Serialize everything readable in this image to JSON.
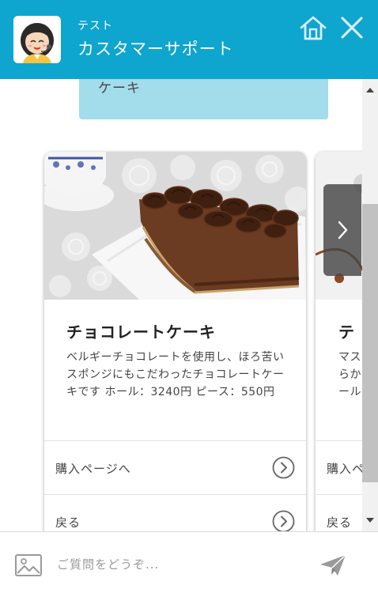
{
  "header": {
    "subtitle": "テスト",
    "title": "カスタマーサポート",
    "bg_color": "#0ea5cf",
    "avatar_icon": "support-operator-avatar",
    "home_icon": "home-icon",
    "close_icon": "close-icon"
  },
  "chat": {
    "user_message": "ケーキ",
    "user_bubble_color": "#a3dceb"
  },
  "carousel": {
    "cards": [
      {
        "image": "chocolate-cake-photo",
        "title": "チョコレートケーキ",
        "description": "ベルギーチョコレートを使用し、ほろ苦いスポンジにもこだわったチョコレートケーキです ホール：3240円 ピース：550円",
        "actions": [
          {
            "label": "購入ページへ",
            "icon": "chevron-right-circle-icon"
          },
          {
            "label": "戻る",
            "icon": "chevron-right-circle-icon"
          }
        ]
      },
      {
        "image": "cake-photo-partial",
        "title": "テ",
        "description_lines": [
          "マス",
          "らか",
          "ール"
        ],
        "actions": [
          {
            "label": "購入ペ"
          },
          {
            "label": "戻る"
          }
        ]
      }
    ],
    "next_icon": "chevron-right-icon"
  },
  "scrollbar": {
    "up_icon": "triangle-up-icon",
    "down_icon": "triangle-down-icon"
  },
  "footer": {
    "input_placeholder": "ご質問をどうぞ...",
    "input_value": "",
    "image_icon": "image-upload-icon",
    "send_icon": "paper-plane-icon"
  }
}
